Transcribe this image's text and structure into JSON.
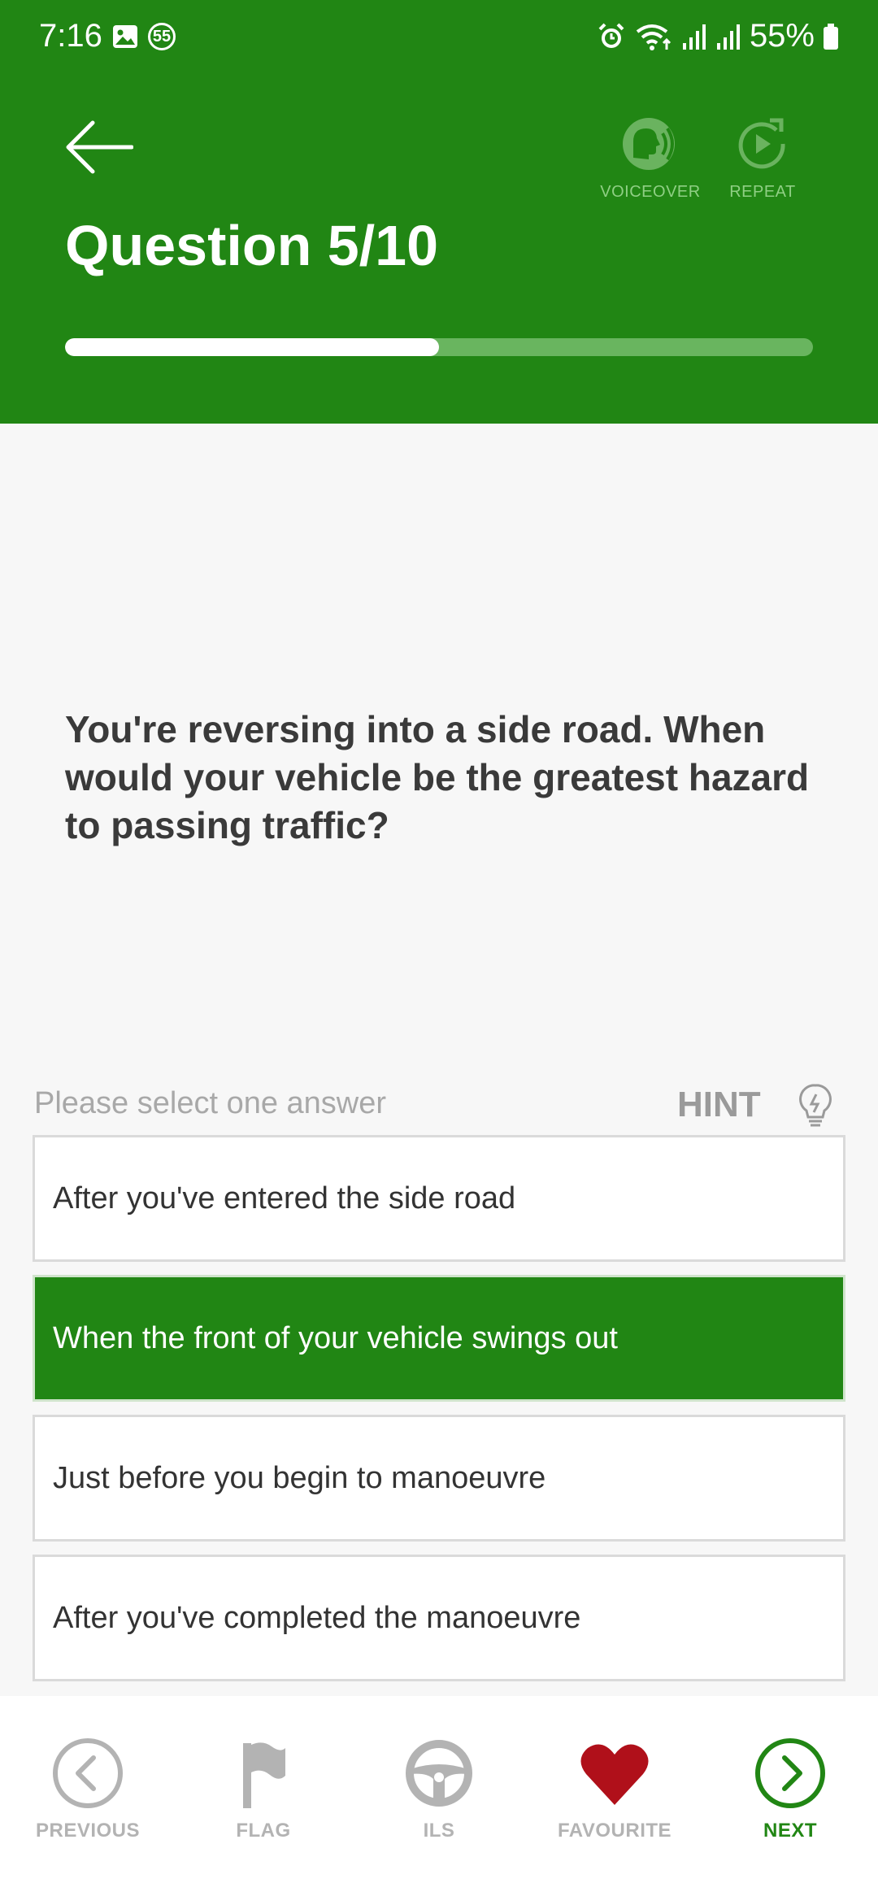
{
  "status_bar": {
    "time": "7:16",
    "notification_count": "55",
    "battery": "55%"
  },
  "header": {
    "title": "Question 5/10",
    "progress": 0.5,
    "voiceover_label": "VOICEOVER",
    "repeat_label": "REPEAT"
  },
  "question": {
    "text": "You're reversing into a side road. When would your vehicle be the greatest hazard to passing traffic?"
  },
  "answer_section": {
    "prompt": "Please select one answer",
    "hint_label": "HINT",
    "answers": [
      {
        "text": "After you've entered the side road",
        "selected": false
      },
      {
        "text": "When the front of your vehicle swings out",
        "selected": true
      },
      {
        "text": "Just before you begin to manoeuvre",
        "selected": false
      },
      {
        "text": "After you've completed the manoeuvre",
        "selected": false
      }
    ]
  },
  "bottom_nav": {
    "previous": "PREVIOUS",
    "flag": "FLAG",
    "ils": "ILS",
    "favourite": "FAVOURITE",
    "next": "NEXT"
  },
  "colors": {
    "primary_green": "#218614",
    "progress_track": "#69b55f",
    "favourite_red": "#b0101a"
  },
  "icons": [
    "image-icon",
    "alarm-icon",
    "wifi-icon",
    "signal-icon",
    "battery-icon",
    "back-arrow-icon",
    "voiceover-icon",
    "repeat-icon",
    "lightbulb-icon",
    "chevron-left-circle-icon",
    "flag-icon",
    "steering-wheel-icon",
    "heart-icon",
    "chevron-right-circle-icon"
  ]
}
